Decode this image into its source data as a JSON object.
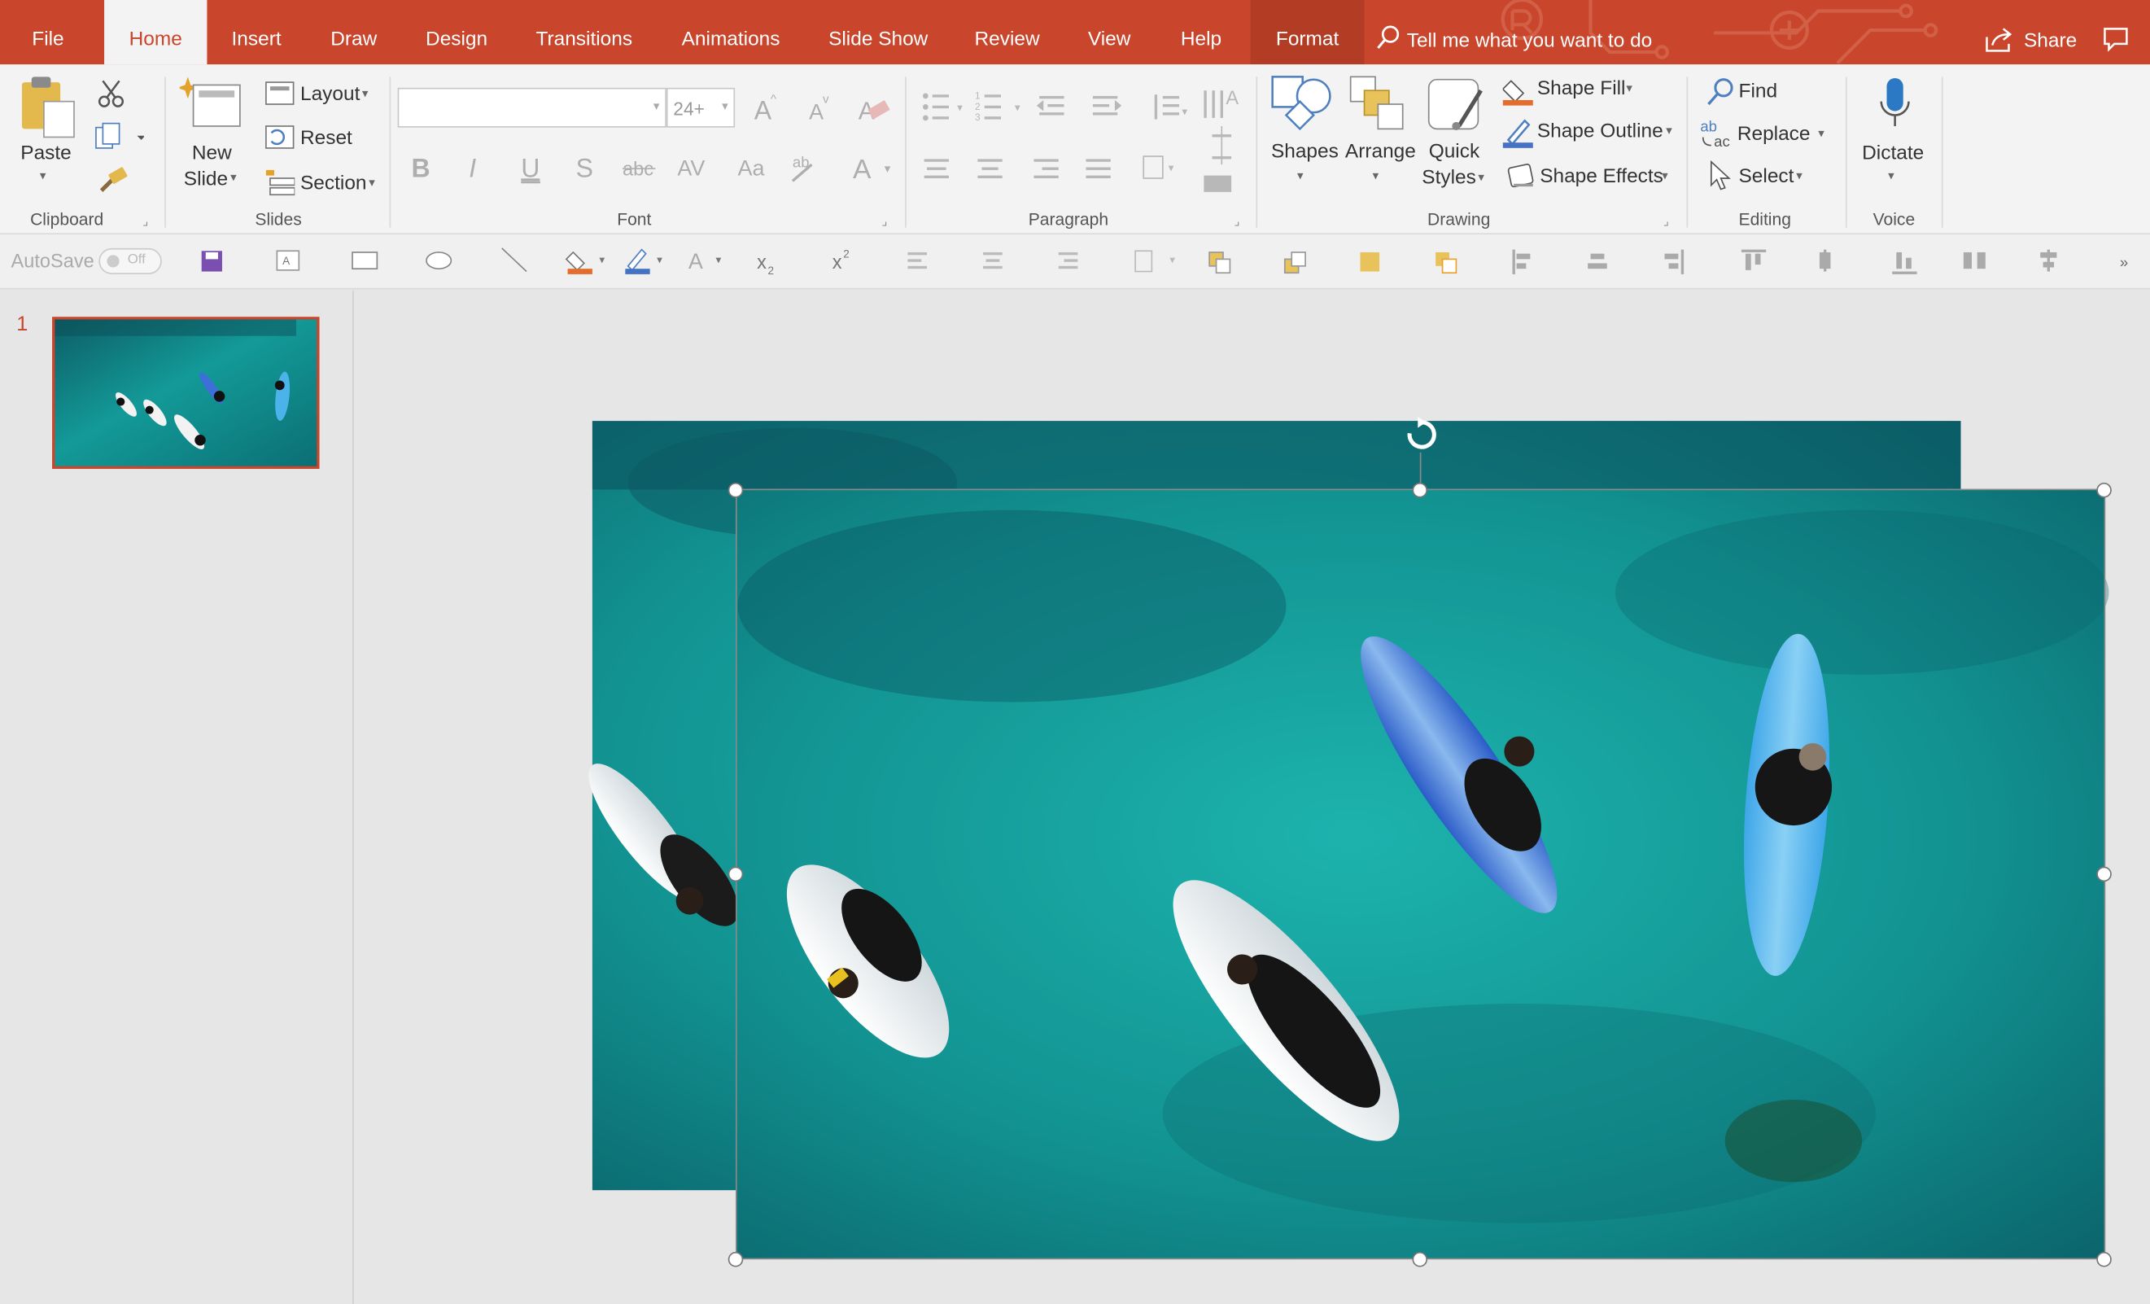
{
  "tabs": [
    "File",
    "Home",
    "Insert",
    "Draw",
    "Design",
    "Transitions",
    "Animations",
    "Slide Show",
    "Review",
    "View",
    "Help",
    "Format"
  ],
  "search": {
    "placeholder": "Tell me what you want to do"
  },
  "share_label": "Share",
  "clipboard": {
    "paste": "Paste",
    "group": "Clipboard"
  },
  "slides": {
    "new_slide_1": "New",
    "new_slide_2": "Slide",
    "layout": "Layout",
    "reset": "Reset",
    "section": "Section",
    "group": "Slides"
  },
  "font": {
    "name": "",
    "size": "24+",
    "group": "Font"
  },
  "paragraph": {
    "group": "Paragraph"
  },
  "drawing": {
    "shapes": "Shapes",
    "arrange": "Arrange",
    "quick_1": "Quick",
    "quick_2": "Styles",
    "shape_fill": "Shape Fill",
    "shape_outline": "Shape Outline",
    "shape_effects": "Shape Effects",
    "group": "Drawing"
  },
  "editing": {
    "find": "Find",
    "replace": "Replace",
    "select": "Select",
    "group": "Editing"
  },
  "voice": {
    "dictate": "Dictate",
    "group": "Voice"
  },
  "qat": {
    "autosave": "AutoSave",
    "toggle": "Off"
  },
  "slide_pane": {
    "number": "1"
  },
  "colors": {
    "accent": "#c9452b",
    "ctx_tab": "#b23c24",
    "ocean": "#1a9e9c",
    "ocean_dark": "#0c4d57"
  },
  "icons": [
    "scissors-icon",
    "copy-icon",
    "format-painter-icon",
    "search-icon",
    "share-icon",
    "comment-icon",
    "microphone-icon",
    "find-icon",
    "replace-icon",
    "select-cursor-icon",
    "rotate-handle-icon"
  ]
}
